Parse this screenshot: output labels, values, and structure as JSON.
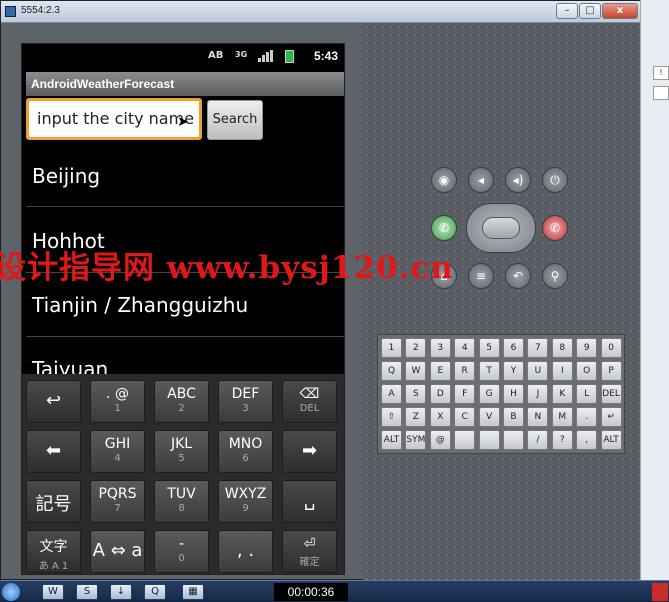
{
  "window": {
    "title": "5554:2.3",
    "minimize": "–",
    "maximize": "□",
    "close": "x"
  },
  "status_bar": {
    "ab": "AB",
    "network": "3G",
    "time": "5:43"
  },
  "app": {
    "title": "AndroidWeatherForecast"
  },
  "search": {
    "input_value": "input the city name",
    "button_label": "Search"
  },
  "cities": [
    "Beijing",
    "Hohhot",
    "Tianjin / Zhangguizhu",
    "Taiyuan"
  ],
  "watermark": "设计指导网 www.bysj120.cn",
  "keyboard": {
    "rows": [
      [
        {
          "main": "↩",
          "sub": ""
        },
        {
          "main": ". @",
          "sub": "1"
        },
        {
          "main": "ABC",
          "sub": "2"
        },
        {
          "main": "DEF",
          "sub": "3"
        },
        {
          "main": "⌫",
          "sub": "DEL"
        }
      ],
      [
        {
          "main": "⬅",
          "sub": ""
        },
        {
          "main": "GHI",
          "sub": "4"
        },
        {
          "main": "JKL",
          "sub": "5"
        },
        {
          "main": "MNO",
          "sub": "6"
        },
        {
          "main": "➡",
          "sub": ""
        }
      ],
      [
        {
          "main": "記号",
          "sub": ""
        },
        {
          "main": "PQRS",
          "sub": "7"
        },
        {
          "main": "TUV",
          "sub": "8"
        },
        {
          "main": "WXYZ",
          "sub": "9"
        },
        {
          "main": "␣",
          "sub": ""
        }
      ],
      [
        {
          "main": "文字",
          "sub": "あ A 1"
        },
        {
          "main": "A ⇔ a",
          "sub": ""
        },
        {
          "main": "-",
          "sub": "0"
        },
        {
          "main": ", .",
          "sub": ""
        },
        {
          "main": "⏎",
          "sub": "確定"
        }
      ]
    ]
  },
  "hardware_keys": {
    "row1": [
      "1",
      "2",
      "3",
      "4",
      "5",
      "6",
      "7",
      "8",
      "9",
      "0"
    ],
    "row2": [
      "Q",
      "W",
      "E",
      "R",
      "T",
      "Y",
      "U",
      "I",
      "O",
      "P"
    ],
    "row3": [
      "A",
      "S",
      "D",
      "F",
      "G",
      "H",
      "J",
      "K",
      "L",
      "DEL"
    ],
    "row4": [
      "⇧",
      "Z",
      "X",
      "C",
      "V",
      "B",
      "N",
      "M",
      ".",
      "↵"
    ],
    "row5": [
      "ALT",
      "SYM",
      "@",
      "",
      "",
      "",
      "/",
      "?",
      ",",
      "ALT"
    ]
  },
  "taskbar": {
    "clock": "00:00:36"
  }
}
